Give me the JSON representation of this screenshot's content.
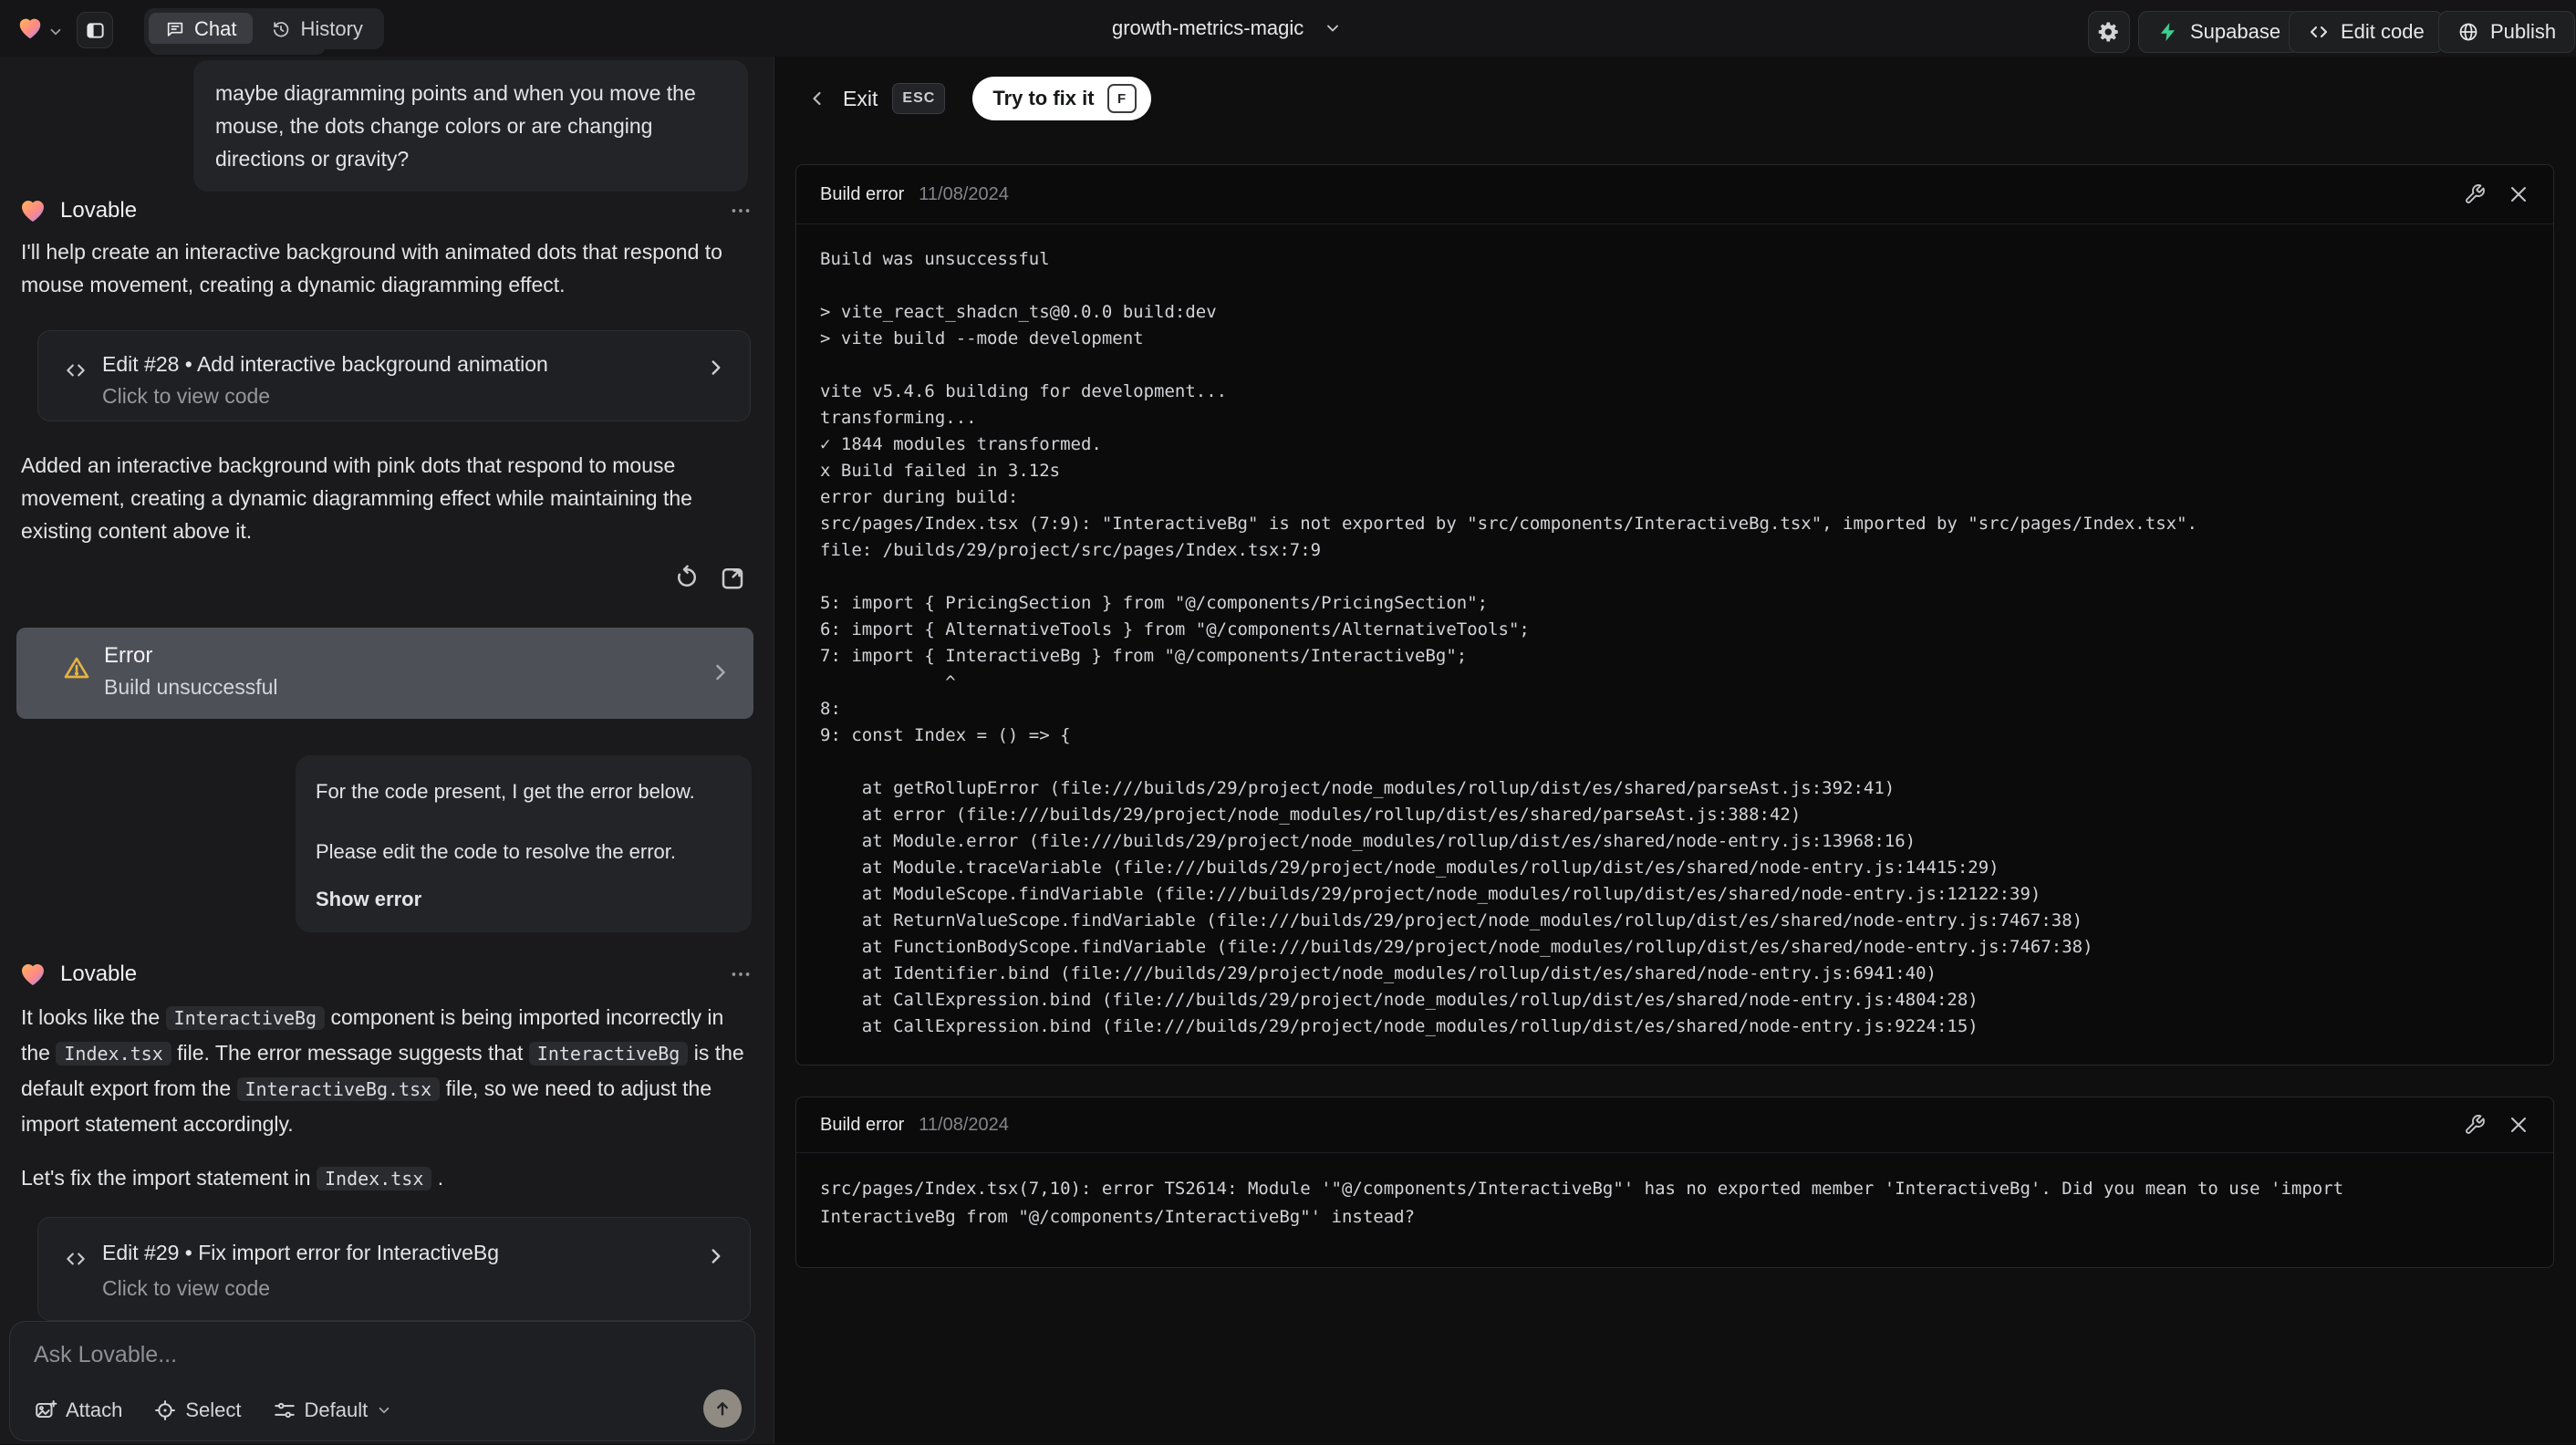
{
  "topbar": {
    "project_name": "growth-metrics-magic",
    "tabs": {
      "chat": "Chat",
      "history": "History"
    },
    "actions": {
      "supabase": "Supabase",
      "edit_code": "Edit code",
      "publish": "Publish"
    },
    "accent_colors": {
      "supabase_green": "#3ecf8e",
      "warning_yellow": "#e3b341"
    }
  },
  "icons": {
    "brand": "heart-gradient-icon",
    "sidebar": "panel-left-icon",
    "chat_tab": "chat-bubble-icon",
    "history_tab": "history-clock-icon",
    "settings": "gear-icon",
    "edit_code": "code-brackets-icon",
    "publish": "globe-icon",
    "message_menu": "ellipsis-icon",
    "restore": "refresh-ccw-icon",
    "open_preview": "open-external-icon",
    "error": "warning-triangle-icon",
    "panel_fix": "wrench-icon",
    "panel_close": "close-x-icon",
    "attach": "image-plus-icon",
    "select": "crosshair-icon",
    "mode": "sliders-icon",
    "send": "arrow-up-icon"
  },
  "chat": {
    "user_message_1": "maybe diagramming points and when you move the mouse, the dots change colors or are changing directions or gravity?",
    "assistant_1": {
      "author": "Lovable",
      "intro": "I'll help create an interactive background with animated dots that respond to mouse movement, creating a dynamic diagramming effect.",
      "edit_card": {
        "title": "Edit #28 • Add interactive background animation",
        "subtitle": "Click to view code"
      },
      "summary": "Added an interactive background with pink dots that respond to mouse movement, creating a dynamic diagramming effect while maintaining the existing content above it.",
      "error_card": {
        "title": "Error",
        "subtitle": "Build unsuccessful"
      }
    },
    "user_message_2": {
      "line1": "For the code present, I get the error below.",
      "line2": "Please edit the code to resolve the error.",
      "action": "Show error"
    },
    "assistant_2": {
      "author": "Lovable",
      "paragraph": [
        {
          "t": "text",
          "v": "It looks like the "
        },
        {
          "t": "code",
          "v": "InteractiveBg"
        },
        {
          "t": "text",
          "v": " component is being imported incorrectly in the "
        },
        {
          "t": "code",
          "v": "Index.tsx"
        },
        {
          "t": "text",
          "v": " file. The error message suggests that "
        },
        {
          "t": "code",
          "v": "InteractiveBg"
        },
        {
          "t": "text",
          "v": " is the default export from the "
        },
        {
          "t": "code",
          "v": "InteractiveBg.tsx"
        },
        {
          "t": "text",
          "v": " file, so we need to adjust the import statement accordingly."
        }
      ],
      "closing": [
        {
          "t": "text",
          "v": "Let's fix the import statement in "
        },
        {
          "t": "code",
          "v": "Index.tsx"
        },
        {
          "t": "text",
          "v": " ."
        }
      ],
      "edit_card": {
        "title": "Edit #29 • Fix import error for InteractiveBg",
        "subtitle": "Click to view code"
      }
    },
    "composer": {
      "placeholder": "Ask Lovable...",
      "attach": "Attach",
      "select": "Select",
      "mode": "Default"
    }
  },
  "preview": {
    "exit": "Exit",
    "exit_key": "ESC",
    "fix_button": "Try to fix it",
    "fix_key": "F",
    "panels": [
      {
        "title": "Build error",
        "date": "11/08/2024",
        "lines": [
          "Build was unsuccessful",
          "",
          "> vite_react_shadcn_ts@0.0.0 build:dev",
          "> vite build --mode development",
          "",
          "vite v5.4.6 building for development...",
          "transforming...",
          "✓ 1844 modules transformed.",
          "x Build failed in 3.12s",
          "error during build:",
          "src/pages/Index.tsx (7:9): \"InteractiveBg\" is not exported by \"src/components/InteractiveBg.tsx\", imported by \"src/pages/Index.tsx\".",
          "file: /builds/29/project/src/pages/Index.tsx:7:9",
          "",
          "5: import { PricingSection } from \"@/components/PricingSection\";",
          "6: import { AlternativeTools } from \"@/components/AlternativeTools\";",
          "7: import { InteractiveBg } from \"@/components/InteractiveBg\";",
          "            ^",
          "8: ",
          "9: const Index = () => {",
          "",
          "    at getRollupError (file:///builds/29/project/node_modules/rollup/dist/es/shared/parseAst.js:392:41)",
          "    at error (file:///builds/29/project/node_modules/rollup/dist/es/shared/parseAst.js:388:42)",
          "    at Module.error (file:///builds/29/project/node_modules/rollup/dist/es/shared/node-entry.js:13968:16)",
          "    at Module.traceVariable (file:///builds/29/project/node_modules/rollup/dist/es/shared/node-entry.js:14415:29)",
          "    at ModuleScope.findVariable (file:///builds/29/project/node_modules/rollup/dist/es/shared/node-entry.js:12122:39)",
          "    at ReturnValueScope.findVariable (file:///builds/29/project/node_modules/rollup/dist/es/shared/node-entry.js:7467:38)",
          "    at FunctionBodyScope.findVariable (file:///builds/29/project/node_modules/rollup/dist/es/shared/node-entry.js:7467:38)",
          "    at Identifier.bind (file:///builds/29/project/node_modules/rollup/dist/es/shared/node-entry.js:6941:40)",
          "    at CallExpression.bind (file:///builds/29/project/node_modules/rollup/dist/es/shared/node-entry.js:4804:28)",
          "    at CallExpression.bind (file:///builds/29/project/node_modules/rollup/dist/es/shared/node-entry.js:9224:15)"
        ]
      },
      {
        "title": "Build error",
        "date": "11/08/2024",
        "lines": [
          "src/pages/Index.tsx(7,10): error TS2614: Module '\"@/components/InteractiveBg\"' has no exported member 'InteractiveBg'. Did you mean to use 'import",
          "InteractiveBg from \"@/components/InteractiveBg\"' instead?"
        ]
      }
    ]
  }
}
